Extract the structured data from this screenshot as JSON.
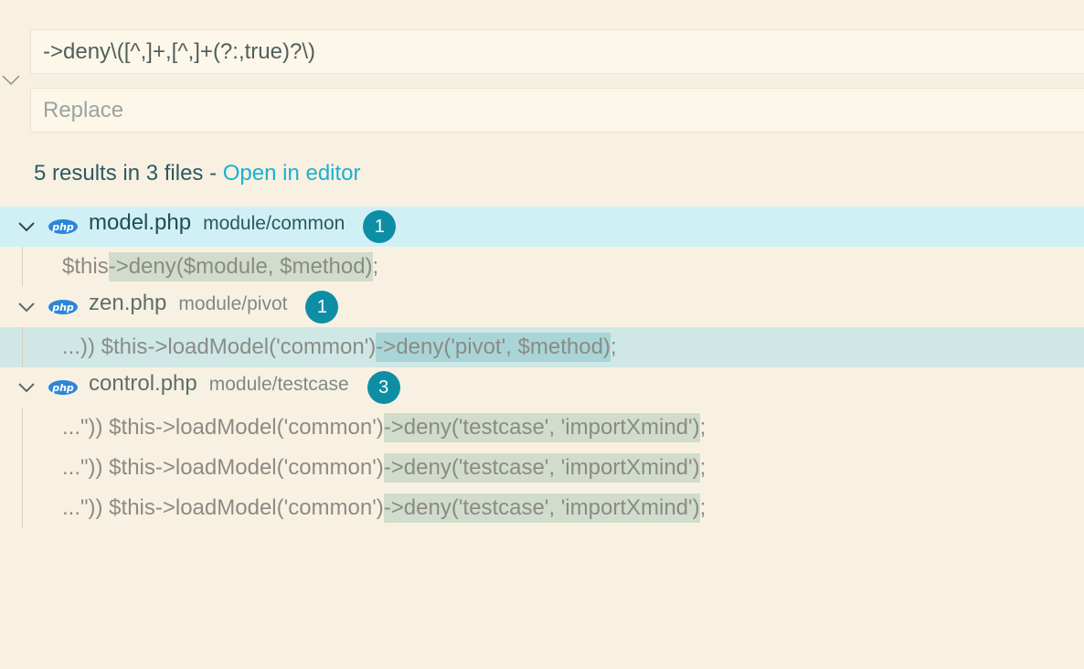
{
  "search": {
    "find_value": "->deny\\([^,]+,[^,]+(?:,true)?\\)",
    "replace_placeholder": "Replace"
  },
  "summary": {
    "count_text": "5 results in 3 files - ",
    "open_link": "Open in editor"
  },
  "files": [
    {
      "name": "model.php",
      "path": "module/common",
      "count": "1",
      "icon_label": "php",
      "matches": [
        {
          "before": "$this",
          "match": "->deny($module, $method)",
          "after": ";"
        }
      ]
    },
    {
      "name": "zen.php",
      "path": "module/pivot",
      "count": "1",
      "icon_label": "php",
      "matches": [
        {
          "before": "...)) $this->loadModel('common')",
          "match": "->deny('pivot', $method)",
          "after": ";"
        }
      ]
    },
    {
      "name": "control.php",
      "path": "module/testcase",
      "count": "3",
      "icon_label": "php",
      "matches": [
        {
          "before": "...\")) $this->loadModel('common')",
          "match": "->deny('testcase', 'importXmind')",
          "after": ";"
        },
        {
          "before": "...\")) $this->loadModel('common')",
          "match": "->deny('testcase', 'importXmind')",
          "after": ";"
        },
        {
          "before": "...\")) $this->loadModel('common')",
          "match": "->deny('testcase', 'importXmind')",
          "after": ";"
        }
      ]
    }
  ],
  "colors": {
    "background": "#f8f1e2",
    "accent_link": "#1ab1d0",
    "badge": "#0e8ea5",
    "selected_file_row": "#d1f0f5",
    "selected_match_row": "#cfe8e6",
    "match_highlight": "#d2dccd"
  }
}
